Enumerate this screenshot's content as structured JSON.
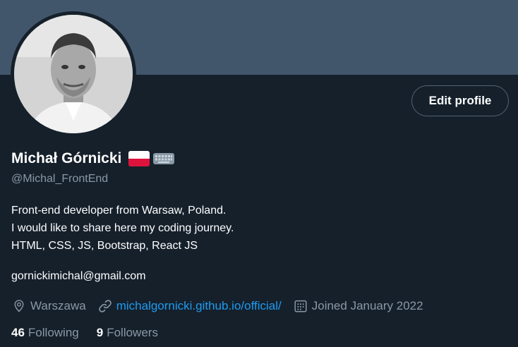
{
  "profile": {
    "name": "Michał Górnicki",
    "handle": "@Michal_FrontEnd",
    "bio_lines": [
      "Front-end developer from Warsaw, Poland.",
      "I would like to share here my coding journey.",
      "HTML, CSS, JS, Bootstrap, React JS"
    ],
    "email": "gornickimichal@gmail.com",
    "location": "Warszawa",
    "website": "michalgornicki.github.io/official/",
    "joined": "Joined January 2022",
    "following_count": "46",
    "following_label": "Following",
    "followers_count": "9",
    "followers_label": "Followers"
  },
  "actions": {
    "edit_profile": "Edit profile"
  },
  "icons": {
    "flag": "poland-flag-icon",
    "keyboard": "keyboard-icon",
    "location": "location-pin-icon",
    "link": "link-icon",
    "calendar": "calendar-icon"
  },
  "colors": {
    "background": "#15202b",
    "banner": "#42566b",
    "accent": "#1d9bf0",
    "muted": "#8b98a5"
  }
}
